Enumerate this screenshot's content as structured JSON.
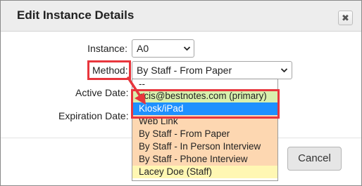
{
  "dialog": {
    "title": "Edit Instance Details",
    "close_symbol": "✖",
    "close_icon": "close-icon"
  },
  "form": {
    "instance_label": "Instance:",
    "instance_value": "A0",
    "method_label": "Method:",
    "method_value": "By Staff - From Paper",
    "active_date_label": "Active Date:",
    "expiration_date_label": "Expiration Date:",
    "chevron_symbol": "⌄"
  },
  "footer": {
    "cancel_label": "Cancel"
  },
  "method_options": [
    {
      "label": "--",
      "style": "plain"
    },
    {
      "label": "ncis@bestnotes.com (primary)",
      "style": "green"
    },
    {
      "label": "Kiosk/iPad",
      "style": "selected"
    },
    {
      "label": "Web Link",
      "style": "orange"
    },
    {
      "label": "By Staff - From Paper",
      "style": "orange"
    },
    {
      "label": "By Staff - In Person Interview",
      "style": "orange"
    },
    {
      "label": "By Staff - Phone Interview",
      "style": "orange"
    },
    {
      "label": "Lacey Doe (Staff)",
      "style": "yellow"
    }
  ],
  "colors": {
    "highlight": "#e8363d",
    "selected_option": "#1e90ff",
    "green_option": "#d9f0ad",
    "orange_option": "#fdd7b1",
    "yellow_option": "#fff7b3"
  }
}
